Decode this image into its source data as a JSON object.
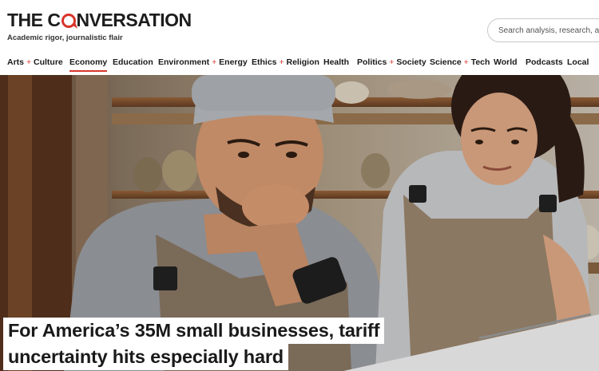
{
  "header": {
    "logo_text_before": "THE C",
    "logo_text_after": "NVERSATION",
    "tagline": "Academic rigor, journalistic flair",
    "search_placeholder": "Search analysis, research, academics…"
  },
  "nav": {
    "active": "Economy",
    "items": [
      {
        "label_a": "Arts",
        "label_b": "Culture"
      },
      {
        "label": "Economy"
      },
      {
        "label": "Education"
      },
      {
        "label_a": "Environment",
        "label_b": "Energy"
      },
      {
        "label_a": "Ethics",
        "label_b": "Religion"
      },
      {
        "label": "Health"
      },
      {
        "label_a": "Politics",
        "label_b": "Society"
      },
      {
        "label_a": "Science",
        "label_b": "Tech"
      },
      {
        "label": "World"
      },
      {
        "label": "Podcasts"
      },
      {
        "label": "Local"
      }
    ]
  },
  "hero": {
    "headline_line1": "For America’s 35M small businesses, tariff",
    "headline_line2": "uncertainty hits especially hard"
  },
  "colors": {
    "brand_red": "#d8352a",
    "text": "#1a1a1a"
  }
}
